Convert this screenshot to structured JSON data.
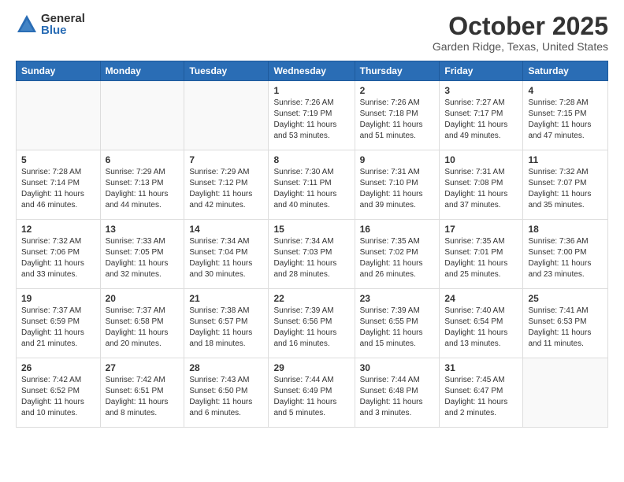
{
  "logo": {
    "general": "General",
    "blue": "Blue"
  },
  "title": "October 2025",
  "subtitle": "Garden Ridge, Texas, United States",
  "headers": [
    "Sunday",
    "Monday",
    "Tuesday",
    "Wednesday",
    "Thursday",
    "Friday",
    "Saturday"
  ],
  "weeks": [
    [
      {
        "day": "",
        "info": ""
      },
      {
        "day": "",
        "info": ""
      },
      {
        "day": "",
        "info": ""
      },
      {
        "day": "1",
        "info": "Sunrise: 7:26 AM\nSunset: 7:19 PM\nDaylight: 11 hours and 53 minutes."
      },
      {
        "day": "2",
        "info": "Sunrise: 7:26 AM\nSunset: 7:18 PM\nDaylight: 11 hours and 51 minutes."
      },
      {
        "day": "3",
        "info": "Sunrise: 7:27 AM\nSunset: 7:17 PM\nDaylight: 11 hours and 49 minutes."
      },
      {
        "day": "4",
        "info": "Sunrise: 7:28 AM\nSunset: 7:15 PM\nDaylight: 11 hours and 47 minutes."
      }
    ],
    [
      {
        "day": "5",
        "info": "Sunrise: 7:28 AM\nSunset: 7:14 PM\nDaylight: 11 hours and 46 minutes."
      },
      {
        "day": "6",
        "info": "Sunrise: 7:29 AM\nSunset: 7:13 PM\nDaylight: 11 hours and 44 minutes."
      },
      {
        "day": "7",
        "info": "Sunrise: 7:29 AM\nSunset: 7:12 PM\nDaylight: 11 hours and 42 minutes."
      },
      {
        "day": "8",
        "info": "Sunrise: 7:30 AM\nSunset: 7:11 PM\nDaylight: 11 hours and 40 minutes."
      },
      {
        "day": "9",
        "info": "Sunrise: 7:31 AM\nSunset: 7:10 PM\nDaylight: 11 hours and 39 minutes."
      },
      {
        "day": "10",
        "info": "Sunrise: 7:31 AM\nSunset: 7:08 PM\nDaylight: 11 hours and 37 minutes."
      },
      {
        "day": "11",
        "info": "Sunrise: 7:32 AM\nSunset: 7:07 PM\nDaylight: 11 hours and 35 minutes."
      }
    ],
    [
      {
        "day": "12",
        "info": "Sunrise: 7:32 AM\nSunset: 7:06 PM\nDaylight: 11 hours and 33 minutes."
      },
      {
        "day": "13",
        "info": "Sunrise: 7:33 AM\nSunset: 7:05 PM\nDaylight: 11 hours and 32 minutes."
      },
      {
        "day": "14",
        "info": "Sunrise: 7:34 AM\nSunset: 7:04 PM\nDaylight: 11 hours and 30 minutes."
      },
      {
        "day": "15",
        "info": "Sunrise: 7:34 AM\nSunset: 7:03 PM\nDaylight: 11 hours and 28 minutes."
      },
      {
        "day": "16",
        "info": "Sunrise: 7:35 AM\nSunset: 7:02 PM\nDaylight: 11 hours and 26 minutes."
      },
      {
        "day": "17",
        "info": "Sunrise: 7:35 AM\nSunset: 7:01 PM\nDaylight: 11 hours and 25 minutes."
      },
      {
        "day": "18",
        "info": "Sunrise: 7:36 AM\nSunset: 7:00 PM\nDaylight: 11 hours and 23 minutes."
      }
    ],
    [
      {
        "day": "19",
        "info": "Sunrise: 7:37 AM\nSunset: 6:59 PM\nDaylight: 11 hours and 21 minutes."
      },
      {
        "day": "20",
        "info": "Sunrise: 7:37 AM\nSunset: 6:58 PM\nDaylight: 11 hours and 20 minutes."
      },
      {
        "day": "21",
        "info": "Sunrise: 7:38 AM\nSunset: 6:57 PM\nDaylight: 11 hours and 18 minutes."
      },
      {
        "day": "22",
        "info": "Sunrise: 7:39 AM\nSunset: 6:56 PM\nDaylight: 11 hours and 16 minutes."
      },
      {
        "day": "23",
        "info": "Sunrise: 7:39 AM\nSunset: 6:55 PM\nDaylight: 11 hours and 15 minutes."
      },
      {
        "day": "24",
        "info": "Sunrise: 7:40 AM\nSunset: 6:54 PM\nDaylight: 11 hours and 13 minutes."
      },
      {
        "day": "25",
        "info": "Sunrise: 7:41 AM\nSunset: 6:53 PM\nDaylight: 11 hours and 11 minutes."
      }
    ],
    [
      {
        "day": "26",
        "info": "Sunrise: 7:42 AM\nSunset: 6:52 PM\nDaylight: 11 hours and 10 minutes."
      },
      {
        "day": "27",
        "info": "Sunrise: 7:42 AM\nSunset: 6:51 PM\nDaylight: 11 hours and 8 minutes."
      },
      {
        "day": "28",
        "info": "Sunrise: 7:43 AM\nSunset: 6:50 PM\nDaylight: 11 hours and 6 minutes."
      },
      {
        "day": "29",
        "info": "Sunrise: 7:44 AM\nSunset: 6:49 PM\nDaylight: 11 hours and 5 minutes."
      },
      {
        "day": "30",
        "info": "Sunrise: 7:44 AM\nSunset: 6:48 PM\nDaylight: 11 hours and 3 minutes."
      },
      {
        "day": "31",
        "info": "Sunrise: 7:45 AM\nSunset: 6:47 PM\nDaylight: 11 hours and 2 minutes."
      },
      {
        "day": "",
        "info": ""
      }
    ]
  ]
}
